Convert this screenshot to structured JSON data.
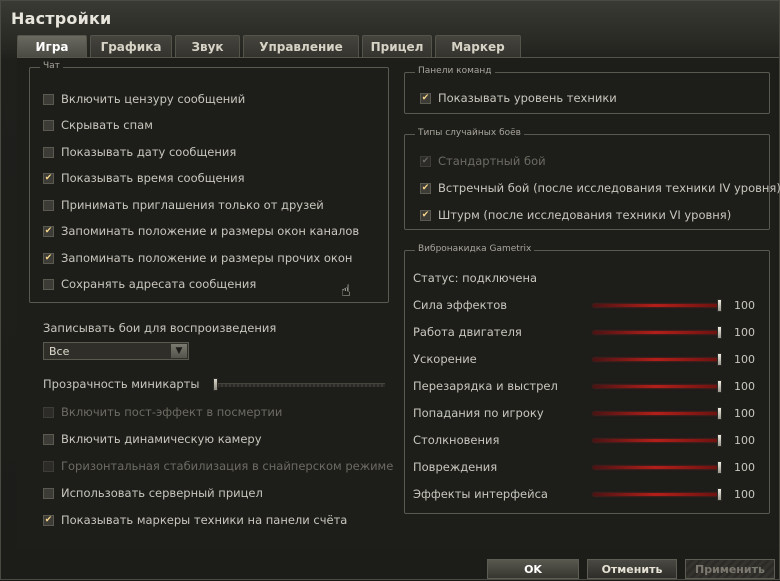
{
  "window": {
    "title": "Настройки"
  },
  "tabs": [
    {
      "label": "Игра",
      "active": true
    },
    {
      "label": "Графика",
      "active": false
    },
    {
      "label": "Звук",
      "active": false
    },
    {
      "label": "Управление",
      "active": false
    },
    {
      "label": "Прицел",
      "active": false
    },
    {
      "label": "Маркер",
      "active": false
    }
  ],
  "chat": {
    "legend": "Чат",
    "items": [
      {
        "label": "Включить цензуру сообщений",
        "checked": false
      },
      {
        "label": "Скрывать спам",
        "checked": false
      },
      {
        "label": "Показывать дату сообщения",
        "checked": false
      },
      {
        "label": "Показывать время сообщения",
        "checked": true
      },
      {
        "label": "Принимать приглашения только от друзей",
        "checked": false
      },
      {
        "label": "Запоминать положение и размеры окон каналов",
        "checked": true
      },
      {
        "label": "Запоминать положение и размеры прочих окон",
        "checked": true
      },
      {
        "label": "Сохранять адресата сообщения",
        "checked": false
      }
    ]
  },
  "record": {
    "label": "Записывать бои для воспроизведения",
    "selected": "Все"
  },
  "minimap": {
    "label": "Прозрачность миникарты",
    "value": 0
  },
  "misc": [
    {
      "label": "Включить пост-эффект в посмертии",
      "checked": false,
      "disabled": true
    },
    {
      "label": "Включить динамическую камеру",
      "checked": false,
      "disabled": false
    },
    {
      "label": "Горизонтальная стабилизация в снайперском режиме",
      "checked": false,
      "disabled": true
    },
    {
      "label": "Использовать серверный прицел",
      "checked": false,
      "disabled": false
    },
    {
      "label": "Показывать маркеры техники на панели счёта",
      "checked": true,
      "disabled": false
    }
  ],
  "team_panels": {
    "legend": "Панели команд",
    "items": [
      {
        "label": "Показывать уровень техники",
        "checked": true
      }
    ]
  },
  "battle_types": {
    "legend": "Типы случайных боёв",
    "items": [
      {
        "label": "Стандартный бой",
        "checked": true,
        "disabled": true
      },
      {
        "label": "Встречный бой (после исследования техники IV уровня)",
        "checked": true,
        "disabled": false
      },
      {
        "label": "Штурм (после исследования техники VI уровня)",
        "checked": true,
        "disabled": false
      }
    ]
  },
  "gametrix": {
    "legend": "Вибронакидка Gametrix",
    "status": "Статус: подключена",
    "sliders": [
      {
        "label": "Сила эффектов",
        "value": "100"
      },
      {
        "label": "Работа двигателя",
        "value": "100"
      },
      {
        "label": "Ускорение",
        "value": "100"
      },
      {
        "label": "Перезарядка и выстрел",
        "value": "100"
      },
      {
        "label": "Попадания по игроку",
        "value": "100"
      },
      {
        "label": "Столкновения",
        "value": "100"
      },
      {
        "label": "Повреждения",
        "value": "100"
      },
      {
        "label": "Эффекты интерфейса",
        "value": "100"
      }
    ]
  },
  "buttons": {
    "ok": "OK",
    "cancel": "Отменить",
    "apply": "Применить"
  },
  "icons": {
    "check": "checkmark-icon",
    "dropdown": "chevron-down-icon",
    "cursor": "hand-cursor-icon"
  },
  "colors": {
    "check": "#f6d58a",
    "slider_red": "#b21f1a"
  }
}
